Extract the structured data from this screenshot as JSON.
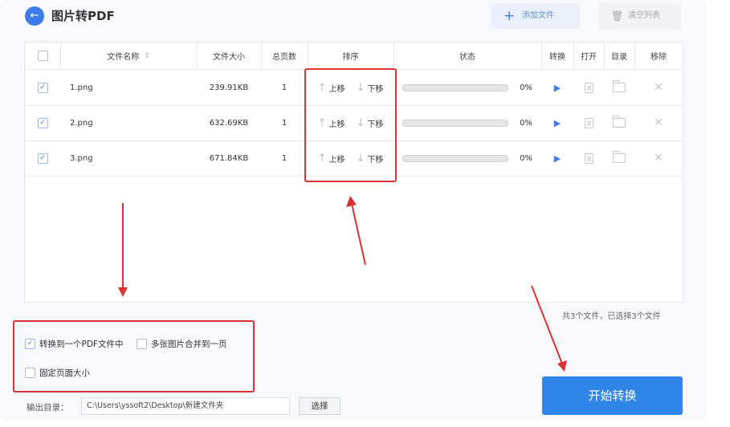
{
  "header": {
    "back_icon": "arrow-left-icon",
    "title": "图片转PDF",
    "add_files": "添加文件",
    "clear_list": "清空列表"
  },
  "table": {
    "columns": {
      "name": "文件名称",
      "size": "文件大小",
      "pages": "总页数",
      "order": "排序",
      "status": "状态",
      "convert": "转换",
      "open": "打开",
      "dir": "目录",
      "remove": "移除"
    },
    "sort_icon": "⇕",
    "rows": [
      {
        "name": "1.png",
        "size": "239.91KB",
        "pages": "1",
        "up": "上移",
        "down": "下移",
        "progress": 0,
        "percent": "0%"
      },
      {
        "name": "2.png",
        "size": "632.69KB",
        "pages": "1",
        "up": "上移",
        "down": "下移",
        "progress": 0,
        "percent": "0%"
      },
      {
        "name": "3.png",
        "size": "671.84KB",
        "pages": "1",
        "up": "上移",
        "down": "下移",
        "progress": 0,
        "percent": "0%"
      }
    ]
  },
  "summary": "共3个文件，已选择3个文件",
  "options": {
    "merge_pdf": {
      "label": "转换到一个PDF文件中",
      "checked": true
    },
    "merge_page": {
      "label": "多张图片合并到一页",
      "checked": false
    },
    "fixed_size": {
      "label": "固定页面大小",
      "checked": false
    }
  },
  "output": {
    "label": "输出目录：",
    "path": "C:\\Users\\yssoft2\\Desktop\\新建文件夹",
    "choose": "选择"
  },
  "start_button": "开始转换",
  "colors": {
    "accent": "#2f86e8",
    "annotation": "#d93333"
  }
}
